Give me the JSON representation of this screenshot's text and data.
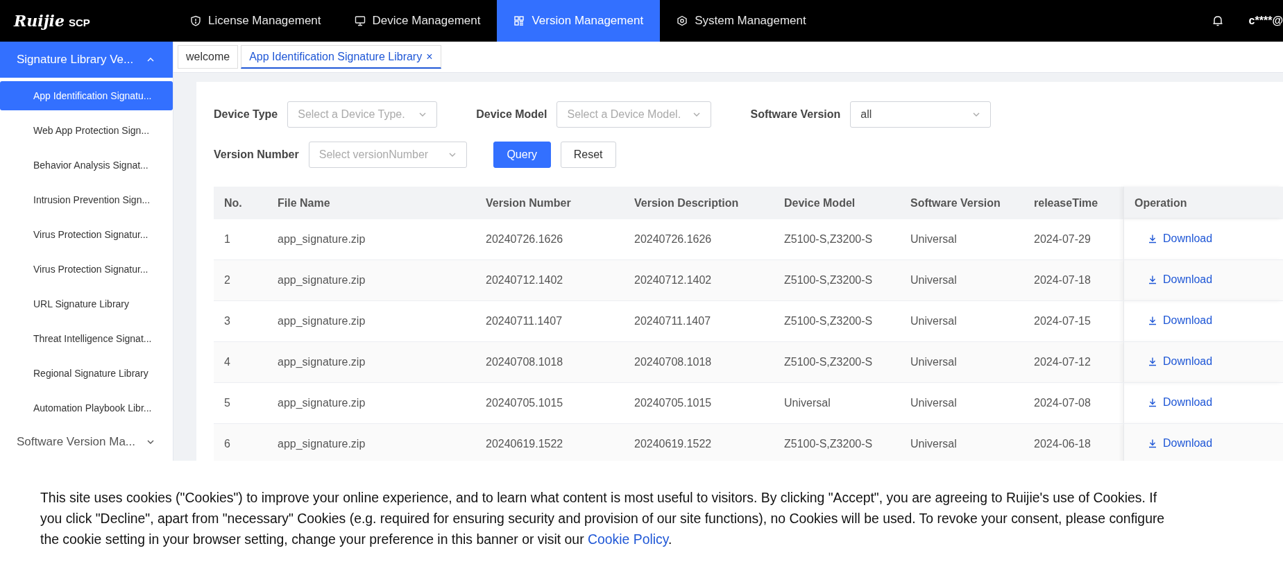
{
  "header": {
    "logo": "Ruijie",
    "product": "SCP",
    "nav": [
      {
        "label": "License Management",
        "selected": false
      },
      {
        "label": "Device Management",
        "selected": false
      },
      {
        "label": "Version Management",
        "selected": true
      },
      {
        "label": "System Management",
        "selected": false
      }
    ],
    "user": "c****@"
  },
  "sidebar": {
    "groups": [
      {
        "label": "Signature Library Ve...",
        "expanded": true,
        "children": [
          {
            "label": "App Identification Signatu...",
            "selected": true
          },
          {
            "label": "Web App Protection Sign...",
            "selected": false
          },
          {
            "label": "Behavior Analysis Signat...",
            "selected": false
          },
          {
            "label": "Intrusion Prevention Sign...",
            "selected": false
          },
          {
            "label": "Virus Protection Signatur...",
            "selected": false
          },
          {
            "label": "Virus Protection Signatur...",
            "selected": false
          },
          {
            "label": "URL Signature Library",
            "selected": false
          },
          {
            "label": "Threat Intelligence Signat...",
            "selected": false
          },
          {
            "label": "Regional Signature Library",
            "selected": false
          },
          {
            "label": "Automation Playbook Libr...",
            "selected": false
          }
        ]
      },
      {
        "label": "Software Version Ma...",
        "expanded": false
      }
    ]
  },
  "page_tabs": [
    {
      "label": "welcome",
      "selected": false
    },
    {
      "label": "App Identification Signature Library",
      "selected": true,
      "close": "×"
    }
  ],
  "filters": [
    {
      "label": "Device Type",
      "placeholder": "Select a Device Type."
    },
    {
      "label": "Device Model",
      "placeholder": "Select a Device Model."
    },
    {
      "label": "Software Version",
      "value": "all"
    },
    {
      "label": "Version Number",
      "placeholder": "Select versionNumber"
    }
  ],
  "buttons": [
    {
      "label": "Query",
      "kind": "primary"
    },
    {
      "label": "Reset",
      "kind": "default"
    }
  ],
  "table": {
    "columns": [
      "No.",
      "File Name",
      "Version Number",
      "Version Description",
      "Device Model",
      "Software Version",
      "releaseTime",
      "Operation"
    ],
    "rows": [
      {
        "cells": [
          "1",
          "app_signature.zip",
          "20240726.1626",
          "20240726.1626",
          "Z5100-S,Z3200-S",
          "Universal",
          "2024-07-29"
        ],
        "action": "Download"
      },
      {
        "cells": [
          "2",
          "app_signature.zip",
          "20240712.1402",
          "20240712.1402",
          "Z5100-S,Z3200-S",
          "Universal",
          "2024-07-18"
        ],
        "action": "Download"
      },
      {
        "cells": [
          "3",
          "app_signature.zip",
          "20240711.1407",
          "20240711.1407",
          "Z5100-S,Z3200-S",
          "Universal",
          "2024-07-15"
        ],
        "action": "Download"
      },
      {
        "cells": [
          "4",
          "app_signature.zip",
          "20240708.1018",
          "20240708.1018",
          "Z5100-S,Z3200-S",
          "Universal",
          "2024-07-12"
        ],
        "action": "Download"
      },
      {
        "cells": [
          "5",
          "app_signature.zip",
          "20240705.1015",
          "20240705.1015",
          "Universal",
          "Universal",
          "2024-07-08"
        ],
        "action": "Download"
      },
      {
        "cells": [
          "6",
          "app_signature.zip",
          "20240619.1522",
          "20240619.1522",
          "Z5100-S,Z3200-S",
          "Universal",
          "2024-06-18"
        ],
        "action": "Download"
      }
    ]
  },
  "cookie_banner": {
    "text": "This site uses cookies (\"Cookies\") to improve your online experience, and to learn what content is most useful to visitors. By clicking \"Accept\", you are agreeing to Ruijie's use of Cookies. If you click \"Decline\", apart from \"necessary\" Cookies (e.g. required for ensuring security and provision of our site functions), no Cookies will be used. To revoke your consent, please configure the cookie setting in your browser setting, change your preference in this banner or visit our",
    "link": "Cookie Policy",
    "end": "."
  }
}
